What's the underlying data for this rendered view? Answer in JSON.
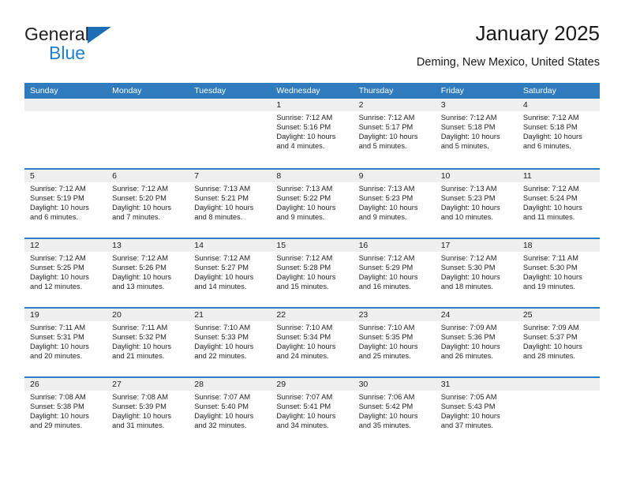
{
  "brand": {
    "name_part1": "General",
    "name_part2": "Blue",
    "triangle_color": "#1d6eb7",
    "blue_text_color": "#1f7fd4"
  },
  "header": {
    "title": "January 2025",
    "subtitle": "Deming, New Mexico, United States"
  },
  "calendar": {
    "accent_color": "#2f7bbe",
    "daynum_band_color": "#efefef",
    "weekday_headers": [
      "Sunday",
      "Monday",
      "Tuesday",
      "Wednesday",
      "Thursday",
      "Friday",
      "Saturday"
    ],
    "weeks": [
      [
        {
          "day": "",
          "sunrise": "",
          "sunset": "",
          "daylight_line1": "",
          "daylight_line2": ""
        },
        {
          "day": "",
          "sunrise": "",
          "sunset": "",
          "daylight_line1": "",
          "daylight_line2": ""
        },
        {
          "day": "",
          "sunrise": "",
          "sunset": "",
          "daylight_line1": "",
          "daylight_line2": ""
        },
        {
          "day": "1",
          "sunrise": "Sunrise: 7:12 AM",
          "sunset": "Sunset: 5:16 PM",
          "daylight_line1": "Daylight: 10 hours",
          "daylight_line2": "and 4 minutes."
        },
        {
          "day": "2",
          "sunrise": "Sunrise: 7:12 AM",
          "sunset": "Sunset: 5:17 PM",
          "daylight_line1": "Daylight: 10 hours",
          "daylight_line2": "and 5 minutes."
        },
        {
          "day": "3",
          "sunrise": "Sunrise: 7:12 AM",
          "sunset": "Sunset: 5:18 PM",
          "daylight_line1": "Daylight: 10 hours",
          "daylight_line2": "and 5 minutes."
        },
        {
          "day": "4",
          "sunrise": "Sunrise: 7:12 AM",
          "sunset": "Sunset: 5:18 PM",
          "daylight_line1": "Daylight: 10 hours",
          "daylight_line2": "and 6 minutes."
        }
      ],
      [
        {
          "day": "5",
          "sunrise": "Sunrise: 7:12 AM",
          "sunset": "Sunset: 5:19 PM",
          "daylight_line1": "Daylight: 10 hours",
          "daylight_line2": "and 6 minutes."
        },
        {
          "day": "6",
          "sunrise": "Sunrise: 7:12 AM",
          "sunset": "Sunset: 5:20 PM",
          "daylight_line1": "Daylight: 10 hours",
          "daylight_line2": "and 7 minutes."
        },
        {
          "day": "7",
          "sunrise": "Sunrise: 7:13 AM",
          "sunset": "Sunset: 5:21 PM",
          "daylight_line1": "Daylight: 10 hours",
          "daylight_line2": "and 8 minutes."
        },
        {
          "day": "8",
          "sunrise": "Sunrise: 7:13 AM",
          "sunset": "Sunset: 5:22 PM",
          "daylight_line1": "Daylight: 10 hours",
          "daylight_line2": "and 9 minutes."
        },
        {
          "day": "9",
          "sunrise": "Sunrise: 7:13 AM",
          "sunset": "Sunset: 5:23 PM",
          "daylight_line1": "Daylight: 10 hours",
          "daylight_line2": "and 9 minutes."
        },
        {
          "day": "10",
          "sunrise": "Sunrise: 7:13 AM",
          "sunset": "Sunset: 5:23 PM",
          "daylight_line1": "Daylight: 10 hours",
          "daylight_line2": "and 10 minutes."
        },
        {
          "day": "11",
          "sunrise": "Sunrise: 7:12 AM",
          "sunset": "Sunset: 5:24 PM",
          "daylight_line1": "Daylight: 10 hours",
          "daylight_line2": "and 11 minutes."
        }
      ],
      [
        {
          "day": "12",
          "sunrise": "Sunrise: 7:12 AM",
          "sunset": "Sunset: 5:25 PM",
          "daylight_line1": "Daylight: 10 hours",
          "daylight_line2": "and 12 minutes."
        },
        {
          "day": "13",
          "sunrise": "Sunrise: 7:12 AM",
          "sunset": "Sunset: 5:26 PM",
          "daylight_line1": "Daylight: 10 hours",
          "daylight_line2": "and 13 minutes."
        },
        {
          "day": "14",
          "sunrise": "Sunrise: 7:12 AM",
          "sunset": "Sunset: 5:27 PM",
          "daylight_line1": "Daylight: 10 hours",
          "daylight_line2": "and 14 minutes."
        },
        {
          "day": "15",
          "sunrise": "Sunrise: 7:12 AM",
          "sunset": "Sunset: 5:28 PM",
          "daylight_line1": "Daylight: 10 hours",
          "daylight_line2": "and 15 minutes."
        },
        {
          "day": "16",
          "sunrise": "Sunrise: 7:12 AM",
          "sunset": "Sunset: 5:29 PM",
          "daylight_line1": "Daylight: 10 hours",
          "daylight_line2": "and 16 minutes."
        },
        {
          "day": "17",
          "sunrise": "Sunrise: 7:12 AM",
          "sunset": "Sunset: 5:30 PM",
          "daylight_line1": "Daylight: 10 hours",
          "daylight_line2": "and 18 minutes."
        },
        {
          "day": "18",
          "sunrise": "Sunrise: 7:11 AM",
          "sunset": "Sunset: 5:30 PM",
          "daylight_line1": "Daylight: 10 hours",
          "daylight_line2": "and 19 minutes."
        }
      ],
      [
        {
          "day": "19",
          "sunrise": "Sunrise: 7:11 AM",
          "sunset": "Sunset: 5:31 PM",
          "daylight_line1": "Daylight: 10 hours",
          "daylight_line2": "and 20 minutes."
        },
        {
          "day": "20",
          "sunrise": "Sunrise: 7:11 AM",
          "sunset": "Sunset: 5:32 PM",
          "daylight_line1": "Daylight: 10 hours",
          "daylight_line2": "and 21 minutes."
        },
        {
          "day": "21",
          "sunrise": "Sunrise: 7:10 AM",
          "sunset": "Sunset: 5:33 PM",
          "daylight_line1": "Daylight: 10 hours",
          "daylight_line2": "and 22 minutes."
        },
        {
          "day": "22",
          "sunrise": "Sunrise: 7:10 AM",
          "sunset": "Sunset: 5:34 PM",
          "daylight_line1": "Daylight: 10 hours",
          "daylight_line2": "and 24 minutes."
        },
        {
          "day": "23",
          "sunrise": "Sunrise: 7:10 AM",
          "sunset": "Sunset: 5:35 PM",
          "daylight_line1": "Daylight: 10 hours",
          "daylight_line2": "and 25 minutes."
        },
        {
          "day": "24",
          "sunrise": "Sunrise: 7:09 AM",
          "sunset": "Sunset: 5:36 PM",
          "daylight_line1": "Daylight: 10 hours",
          "daylight_line2": "and 26 minutes."
        },
        {
          "day": "25",
          "sunrise": "Sunrise: 7:09 AM",
          "sunset": "Sunset: 5:37 PM",
          "daylight_line1": "Daylight: 10 hours",
          "daylight_line2": "and 28 minutes."
        }
      ],
      [
        {
          "day": "26",
          "sunrise": "Sunrise: 7:08 AM",
          "sunset": "Sunset: 5:38 PM",
          "daylight_line1": "Daylight: 10 hours",
          "daylight_line2": "and 29 minutes."
        },
        {
          "day": "27",
          "sunrise": "Sunrise: 7:08 AM",
          "sunset": "Sunset: 5:39 PM",
          "daylight_line1": "Daylight: 10 hours",
          "daylight_line2": "and 31 minutes."
        },
        {
          "day": "28",
          "sunrise": "Sunrise: 7:07 AM",
          "sunset": "Sunset: 5:40 PM",
          "daylight_line1": "Daylight: 10 hours",
          "daylight_line2": "and 32 minutes."
        },
        {
          "day": "29",
          "sunrise": "Sunrise: 7:07 AM",
          "sunset": "Sunset: 5:41 PM",
          "daylight_line1": "Daylight: 10 hours",
          "daylight_line2": "and 34 minutes."
        },
        {
          "day": "30",
          "sunrise": "Sunrise: 7:06 AM",
          "sunset": "Sunset: 5:42 PM",
          "daylight_line1": "Daylight: 10 hours",
          "daylight_line2": "and 35 minutes."
        },
        {
          "day": "31",
          "sunrise": "Sunrise: 7:05 AM",
          "sunset": "Sunset: 5:43 PM",
          "daylight_line1": "Daylight: 10 hours",
          "daylight_line2": "and 37 minutes."
        },
        {
          "day": "",
          "sunrise": "",
          "sunset": "",
          "daylight_line1": "",
          "daylight_line2": ""
        }
      ]
    ]
  }
}
